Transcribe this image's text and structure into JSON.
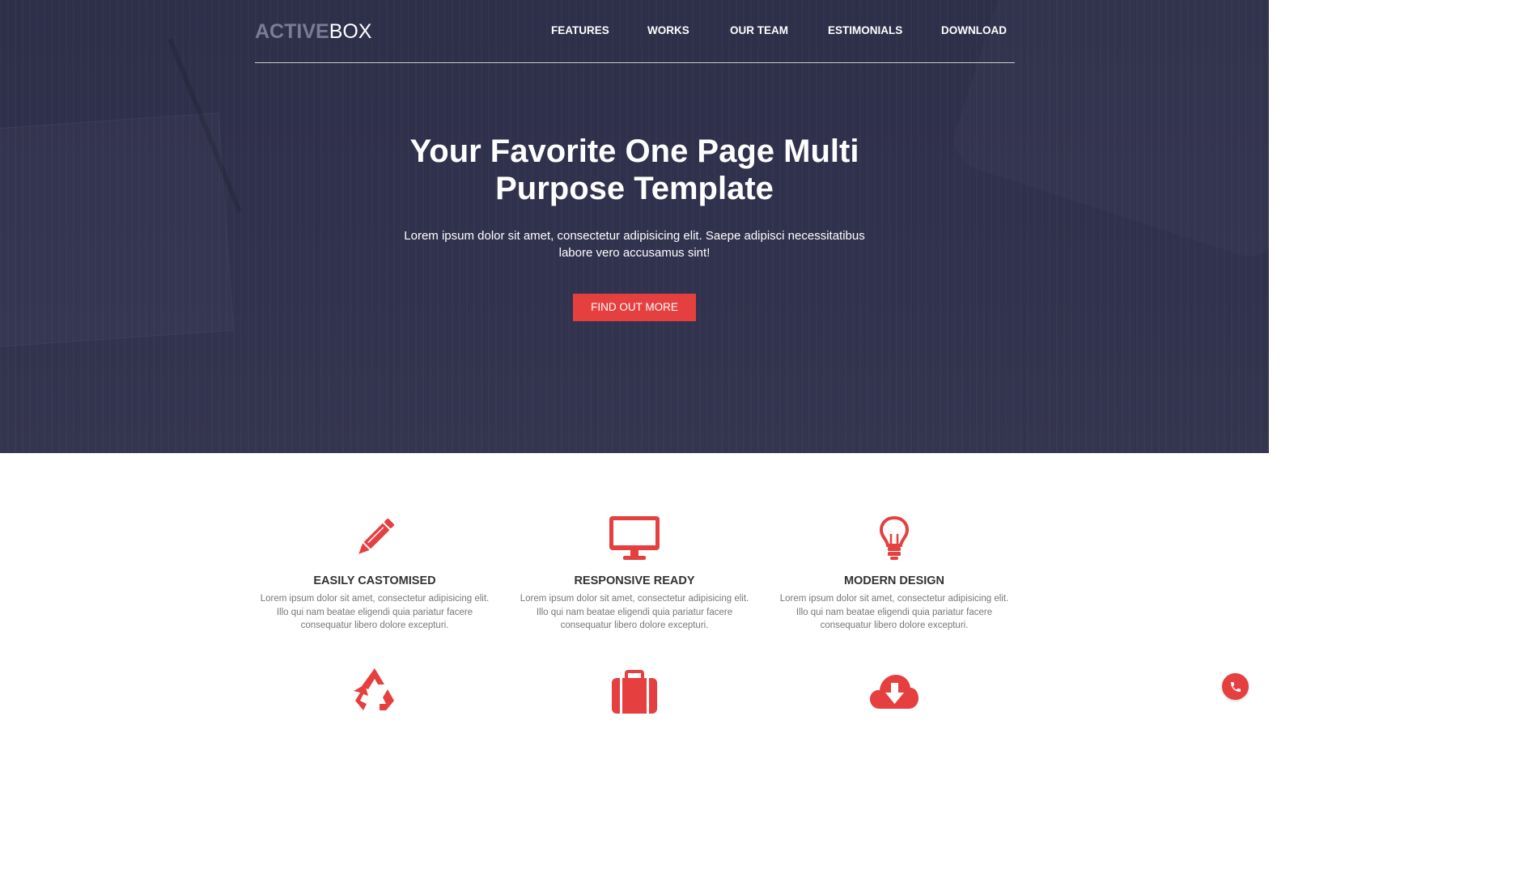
{
  "brand": {
    "part1": "ACTIVE",
    "part2": "BOX"
  },
  "nav": {
    "items": [
      {
        "label": "FEATURES"
      },
      {
        "label": "WORKS"
      },
      {
        "label": "OUR TEAM"
      },
      {
        "label": "ESTIMONIALS"
      },
      {
        "label": "DOWNLOAD"
      }
    ]
  },
  "hero": {
    "title_line1": "Your Favorite One Page Multi",
    "title_line2": "Purpose Template",
    "subtitle_line1": "Lorem ipsum dolor sit amet, consectetur adipisicing elit. Saepe adipisci necessitatibus",
    "subtitle_line2": "labore vero accusamus sint!",
    "cta_label": "FIND OUT MORE"
  },
  "features": [
    {
      "icon": "pencil-icon",
      "title": "EASILY CASTOMISED",
      "line1": "Lorem ipsum dolor sit amet, consectetur adipisicing elit.",
      "line2": "Illo qui nam beatae eligendi quia pariatur facere",
      "line3": "consequatur libero dolore excepturi."
    },
    {
      "icon": "monitor-icon",
      "title": "RESPONSIVE READY",
      "line1": "Lorem ipsum dolor sit amet, consectetur adipisicing elit.",
      "line2": "Illo qui nam beatae eligendi quia pariatur facere",
      "line3": "consequatur libero dolore excepturi."
    },
    {
      "icon": "lightbulb-icon",
      "title": "MODERN DESIGN",
      "line1": "Lorem ipsum dolor sit amet, consectetur adipisicing elit.",
      "line2": "Illo qui nam beatae eligendi quia pariatur facere",
      "line3": "consequatur libero dolore excepturi."
    }
  ],
  "features_row2_icons": [
    "recycle-icon",
    "briefcase-icon",
    "cloud-download-icon"
  ],
  "colors": {
    "accent": "#e5403f",
    "hero_bg": "#30314c",
    "text_dark": "#333333",
    "text_muted": "#777777"
  },
  "floating": {
    "icon": "phone-icon"
  }
}
